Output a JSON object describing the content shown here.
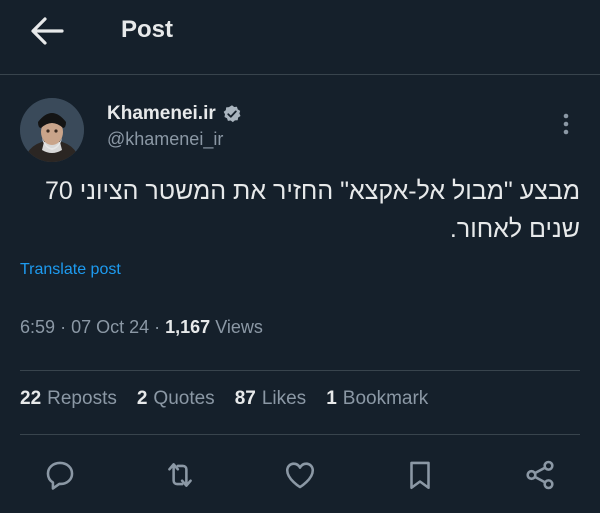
{
  "header": {
    "title": "Post",
    "back_icon": "arrow-left-icon"
  },
  "author": {
    "name": "Khamenei.ir",
    "handle": "@khamenei_ir",
    "verified_icon": "verified-badge-icon",
    "avatar": "avatar"
  },
  "post": {
    "text": "מבצע \"מבול אל-אקצא\" החזיר את המשטר הציוני 70 שנים לאחור.",
    "translate_label": "Translate post",
    "time": "6:59",
    "date": "07 Oct 24",
    "views_count": "1,167",
    "views_label": "Views"
  },
  "stats": [
    {
      "count": "22",
      "label": "Reposts"
    },
    {
      "count": "2",
      "label": "Quotes"
    },
    {
      "count": "87",
      "label": "Likes"
    },
    {
      "count": "1",
      "label": "Bookmark"
    }
  ],
  "actions": [
    {
      "icon": "reply-icon"
    },
    {
      "icon": "repost-icon"
    },
    {
      "icon": "like-icon"
    },
    {
      "icon": "bookmark-icon"
    },
    {
      "icon": "share-icon"
    }
  ],
  "colors": {
    "background": "#15202b",
    "text": "#e7e9ea",
    "secondary": "#8b98a5",
    "accent": "#1d9bf0",
    "divider": "#38444d"
  }
}
